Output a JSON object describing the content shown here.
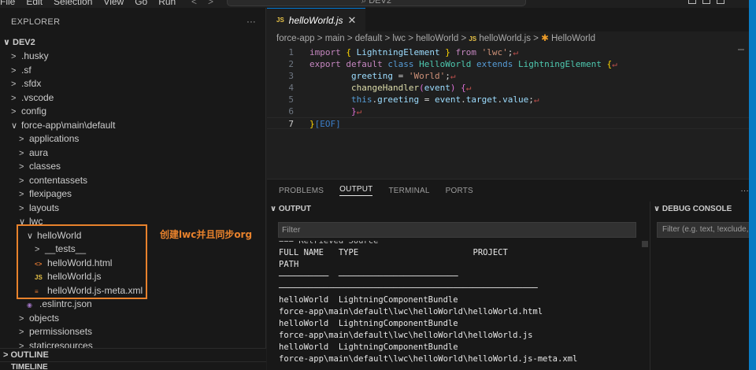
{
  "titlebar": {
    "menu": [
      "File",
      "Edit",
      "Selection",
      "View",
      "Go",
      "Run"
    ],
    "search_text": "⌕ DEV2"
  },
  "sidebar": {
    "title": "EXPLORER",
    "more": "···",
    "root": "DEV2",
    "tree": [
      {
        "label": ".husky",
        "indent": 1,
        "chev": ">",
        "icon": ""
      },
      {
        "label": ".sf",
        "indent": 1,
        "chev": ">",
        "icon": ""
      },
      {
        "label": ".sfdx",
        "indent": 1,
        "chev": ">",
        "icon": ""
      },
      {
        "label": ".vscode",
        "indent": 1,
        "chev": ">",
        "icon": ""
      },
      {
        "label": "config",
        "indent": 1,
        "chev": ">",
        "icon": ""
      },
      {
        "label": "force-app\\main\\default",
        "indent": 1,
        "chev": "∨",
        "icon": ""
      },
      {
        "label": "applications",
        "indent": 2,
        "chev": ">",
        "icon": ""
      },
      {
        "label": "aura",
        "indent": 2,
        "chev": ">",
        "icon": ""
      },
      {
        "label": "classes",
        "indent": 2,
        "chev": ">",
        "icon": ""
      },
      {
        "label": "contentassets",
        "indent": 2,
        "chev": ">",
        "icon": ""
      },
      {
        "label": "flexipages",
        "indent": 2,
        "chev": ">",
        "icon": ""
      },
      {
        "label": "layouts",
        "indent": 2,
        "chev": ">",
        "icon": ""
      },
      {
        "label": "lwc",
        "indent": 2,
        "chev": "∨",
        "icon": ""
      },
      {
        "label": "helloWorld",
        "indent": 3,
        "chev": "∨",
        "icon": ""
      },
      {
        "label": "__tests__",
        "indent": 4,
        "chev": ">",
        "icon": ""
      },
      {
        "label": "helloWorld.html",
        "indent": 4,
        "chev": "",
        "icon": "html"
      },
      {
        "label": "helloWorld.js",
        "indent": 4,
        "chev": "",
        "icon": "js"
      },
      {
        "label": "helloWorld.js-meta.xml",
        "indent": 4,
        "chev": "",
        "icon": "xml"
      },
      {
        "label": ".eslintrc.json",
        "indent": 3,
        "chev": "",
        "icon": "rc"
      },
      {
        "label": "objects",
        "indent": 2,
        "chev": ">",
        "icon": ""
      },
      {
        "label": "permissionsets",
        "indent": 2,
        "chev": ">",
        "icon": ""
      },
      {
        "label": "staticresources",
        "indent": 2,
        "chev": ">",
        "icon": ""
      }
    ],
    "annotation": "创建lwc并且同步org",
    "outline": "OUTLINE",
    "timeline": "TIMELINE"
  },
  "editor": {
    "tab_badge": "JS",
    "tab_label": "helloWorld.js",
    "tab_close": "✕",
    "breadcrumb": [
      "force-app",
      "main",
      "default",
      "lwc",
      "helloWorld",
      "helloWorld.js",
      "HelloWorld"
    ],
    "line_numbers": [
      "1",
      "2",
      "3",
      "4",
      "5",
      "6",
      "7"
    ]
  },
  "panel": {
    "tabs": [
      "PROBLEMS",
      "OUTPUT",
      "TERMINAL",
      "PORTS"
    ],
    "active_tab": "OUTPUT",
    "more": "···",
    "output_header": "OUTPUT",
    "filter_placeholder": "Filter",
    "output_lines": [
      "=== Retrieved Source",
      "FULL NAME   TYPE                       PROJECT",
      "PATH",
      "──────────  ────────────────────────",
      "────────────────────────────────────────────────────",
      "helloWorld  LightningComponentBundle",
      "force-app\\main\\default\\lwc\\helloWorld\\helloWorld.html",
      "helloWorld  LightningComponentBundle",
      "force-app\\main\\default\\lwc\\helloWorld\\helloWorld.js",
      "helloWorld  LightningComponentBundle",
      "force-app\\main\\default\\lwc\\helloWorld\\helloWorld.js-meta.xml"
    ],
    "debug_header": "DEBUG CONSOLE",
    "debug_filter": "Filter (e.g. text, !exclude, \\"
  }
}
